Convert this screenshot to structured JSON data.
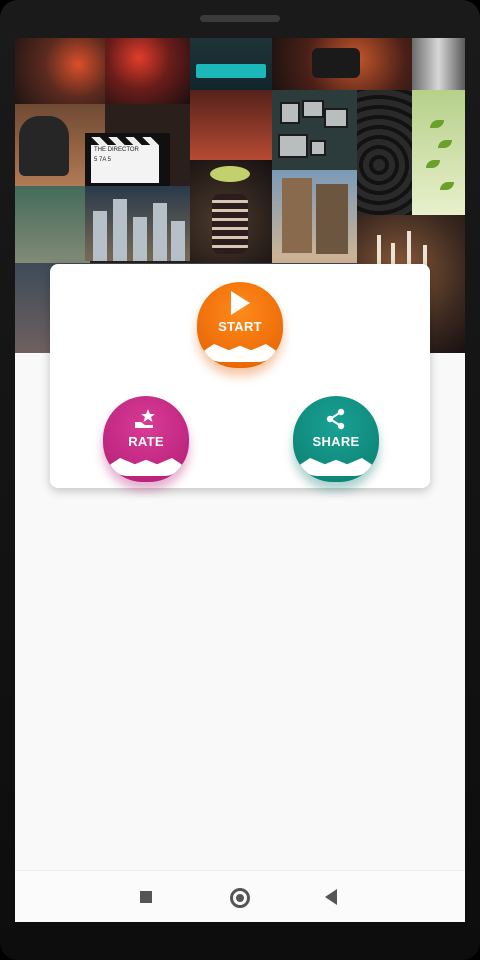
{
  "buttons": {
    "start_label": "START",
    "rate_label": "RATE",
    "share_label": "SHARE"
  },
  "icons": {
    "start": "play-icon",
    "rate": "hand-star-icon",
    "share": "share-icon"
  },
  "collage": {
    "clapperboard_title": "THE DIRECTOR",
    "clapperboard_numbers": "5 7A 5"
  },
  "colors": {
    "start": "#f47513",
    "rate": "#c8287e",
    "share": "#129183",
    "screen_bg": "#f9f9f9"
  },
  "navigation": [
    "stop",
    "home",
    "back"
  ]
}
